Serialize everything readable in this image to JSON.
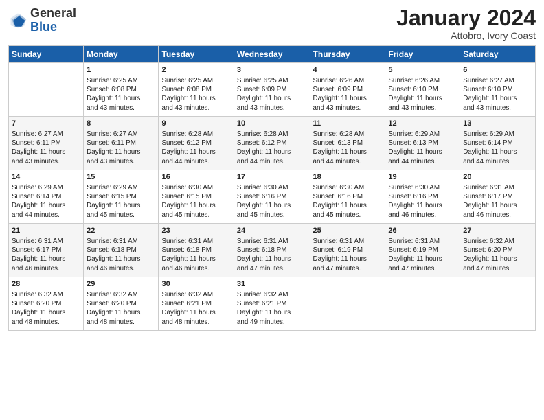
{
  "header": {
    "logo_line1": "General",
    "logo_line2": "Blue",
    "month": "January 2024",
    "location": "Attobro, Ivory Coast"
  },
  "days_of_week": [
    "Sunday",
    "Monday",
    "Tuesday",
    "Wednesday",
    "Thursday",
    "Friday",
    "Saturday"
  ],
  "weeks": [
    [
      {
        "day": "",
        "info": ""
      },
      {
        "day": "1",
        "info": "Sunrise: 6:25 AM\nSunset: 6:08 PM\nDaylight: 11 hours\nand 43 minutes."
      },
      {
        "day": "2",
        "info": "Sunrise: 6:25 AM\nSunset: 6:08 PM\nDaylight: 11 hours\nand 43 minutes."
      },
      {
        "day": "3",
        "info": "Sunrise: 6:25 AM\nSunset: 6:09 PM\nDaylight: 11 hours\nand 43 minutes."
      },
      {
        "day": "4",
        "info": "Sunrise: 6:26 AM\nSunset: 6:09 PM\nDaylight: 11 hours\nand 43 minutes."
      },
      {
        "day": "5",
        "info": "Sunrise: 6:26 AM\nSunset: 6:10 PM\nDaylight: 11 hours\nand 43 minutes."
      },
      {
        "day": "6",
        "info": "Sunrise: 6:27 AM\nSunset: 6:10 PM\nDaylight: 11 hours\nand 43 minutes."
      }
    ],
    [
      {
        "day": "7",
        "info": "Sunrise: 6:27 AM\nSunset: 6:11 PM\nDaylight: 11 hours\nand 43 minutes."
      },
      {
        "day": "8",
        "info": "Sunrise: 6:27 AM\nSunset: 6:11 PM\nDaylight: 11 hours\nand 43 minutes."
      },
      {
        "day": "9",
        "info": "Sunrise: 6:28 AM\nSunset: 6:12 PM\nDaylight: 11 hours\nand 44 minutes."
      },
      {
        "day": "10",
        "info": "Sunrise: 6:28 AM\nSunset: 6:12 PM\nDaylight: 11 hours\nand 44 minutes."
      },
      {
        "day": "11",
        "info": "Sunrise: 6:28 AM\nSunset: 6:13 PM\nDaylight: 11 hours\nand 44 minutes."
      },
      {
        "day": "12",
        "info": "Sunrise: 6:29 AM\nSunset: 6:13 PM\nDaylight: 11 hours\nand 44 minutes."
      },
      {
        "day": "13",
        "info": "Sunrise: 6:29 AM\nSunset: 6:14 PM\nDaylight: 11 hours\nand 44 minutes."
      }
    ],
    [
      {
        "day": "14",
        "info": "Sunrise: 6:29 AM\nSunset: 6:14 PM\nDaylight: 11 hours\nand 44 minutes."
      },
      {
        "day": "15",
        "info": "Sunrise: 6:29 AM\nSunset: 6:15 PM\nDaylight: 11 hours\nand 45 minutes."
      },
      {
        "day": "16",
        "info": "Sunrise: 6:30 AM\nSunset: 6:15 PM\nDaylight: 11 hours\nand 45 minutes."
      },
      {
        "day": "17",
        "info": "Sunrise: 6:30 AM\nSunset: 6:16 PM\nDaylight: 11 hours\nand 45 minutes."
      },
      {
        "day": "18",
        "info": "Sunrise: 6:30 AM\nSunset: 6:16 PM\nDaylight: 11 hours\nand 45 minutes."
      },
      {
        "day": "19",
        "info": "Sunrise: 6:30 AM\nSunset: 6:16 PM\nDaylight: 11 hours\nand 46 minutes."
      },
      {
        "day": "20",
        "info": "Sunrise: 6:31 AM\nSunset: 6:17 PM\nDaylight: 11 hours\nand 46 minutes."
      }
    ],
    [
      {
        "day": "21",
        "info": "Sunrise: 6:31 AM\nSunset: 6:17 PM\nDaylight: 11 hours\nand 46 minutes."
      },
      {
        "day": "22",
        "info": "Sunrise: 6:31 AM\nSunset: 6:18 PM\nDaylight: 11 hours\nand 46 minutes."
      },
      {
        "day": "23",
        "info": "Sunrise: 6:31 AM\nSunset: 6:18 PM\nDaylight: 11 hours\nand 46 minutes."
      },
      {
        "day": "24",
        "info": "Sunrise: 6:31 AM\nSunset: 6:18 PM\nDaylight: 11 hours\nand 47 minutes."
      },
      {
        "day": "25",
        "info": "Sunrise: 6:31 AM\nSunset: 6:19 PM\nDaylight: 11 hours\nand 47 minutes."
      },
      {
        "day": "26",
        "info": "Sunrise: 6:31 AM\nSunset: 6:19 PM\nDaylight: 11 hours\nand 47 minutes."
      },
      {
        "day": "27",
        "info": "Sunrise: 6:32 AM\nSunset: 6:20 PM\nDaylight: 11 hours\nand 47 minutes."
      }
    ],
    [
      {
        "day": "28",
        "info": "Sunrise: 6:32 AM\nSunset: 6:20 PM\nDaylight: 11 hours\nand 48 minutes."
      },
      {
        "day": "29",
        "info": "Sunrise: 6:32 AM\nSunset: 6:20 PM\nDaylight: 11 hours\nand 48 minutes."
      },
      {
        "day": "30",
        "info": "Sunrise: 6:32 AM\nSunset: 6:21 PM\nDaylight: 11 hours\nand 48 minutes."
      },
      {
        "day": "31",
        "info": "Sunrise: 6:32 AM\nSunset: 6:21 PM\nDaylight: 11 hours\nand 49 minutes."
      },
      {
        "day": "",
        "info": ""
      },
      {
        "day": "",
        "info": ""
      },
      {
        "day": "",
        "info": ""
      }
    ]
  ]
}
